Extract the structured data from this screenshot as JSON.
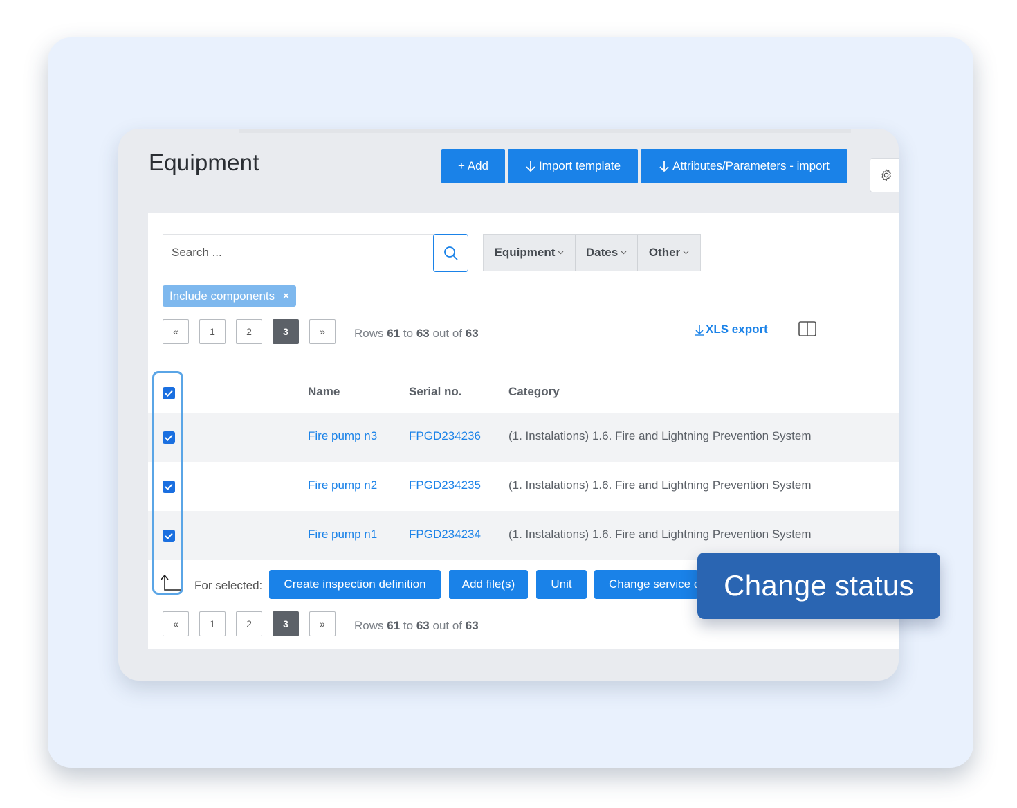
{
  "page": {
    "title": "Equipment"
  },
  "toolbar": {
    "add_label": "+ Add",
    "import_template_label": "Import template",
    "attributes_import_label": "Attributes/Parameters - import"
  },
  "search": {
    "placeholder": "Search ..."
  },
  "filters": [
    "Equipment",
    "Dates",
    "Other"
  ],
  "chips": [
    {
      "label": "Include components",
      "remove": "×"
    }
  ],
  "pagination": {
    "first": "«",
    "last": "»",
    "pages": [
      "1",
      "2",
      "3"
    ],
    "current": "3",
    "rows_prefix": "Rows",
    "rows_from": "61",
    "rows_to_word": "to",
    "rows_to": "63",
    "rows_out_of": "out of",
    "rows_total": "63"
  },
  "export": {
    "label": "XLS export"
  },
  "table": {
    "columns": [
      "Name",
      "Serial no.",
      "Category"
    ],
    "rows": [
      {
        "name": "Fire pump n3",
        "serial": "FPGD234236",
        "category": "(1. Instalations) 1.6. Fire and Lightning Prevention System",
        "checked": true
      },
      {
        "name": "Fire pump n2",
        "serial": "FPGD234235",
        "category": "(1. Instalations) 1.6. Fire and Lightning Prevention System",
        "checked": true
      },
      {
        "name": "Fire pump n1",
        "serial": "FPGD234234",
        "category": "(1. Instalations) 1.6. Fire and Lightning Prevention System",
        "checked": true
      }
    ],
    "select_all_checked": true
  },
  "bulk_actions": {
    "label": "For selected:",
    "buttons": [
      "Create inspection definition",
      "Add file(s)",
      "Unit",
      "Change service d"
    ]
  },
  "tooltip": {
    "text": "Change status"
  },
  "icons": {
    "search": "search-icon",
    "gear": "gear-icon",
    "download": "download-arrow-icon",
    "columns": "columns-icon",
    "chevron": "chevron-down-icon",
    "check": "check-icon"
  },
  "colors": {
    "accent": "#1a82e8",
    "tooltip": "#2a65b2",
    "chip": "#7eb8ee",
    "background": "#e9f1fd"
  }
}
